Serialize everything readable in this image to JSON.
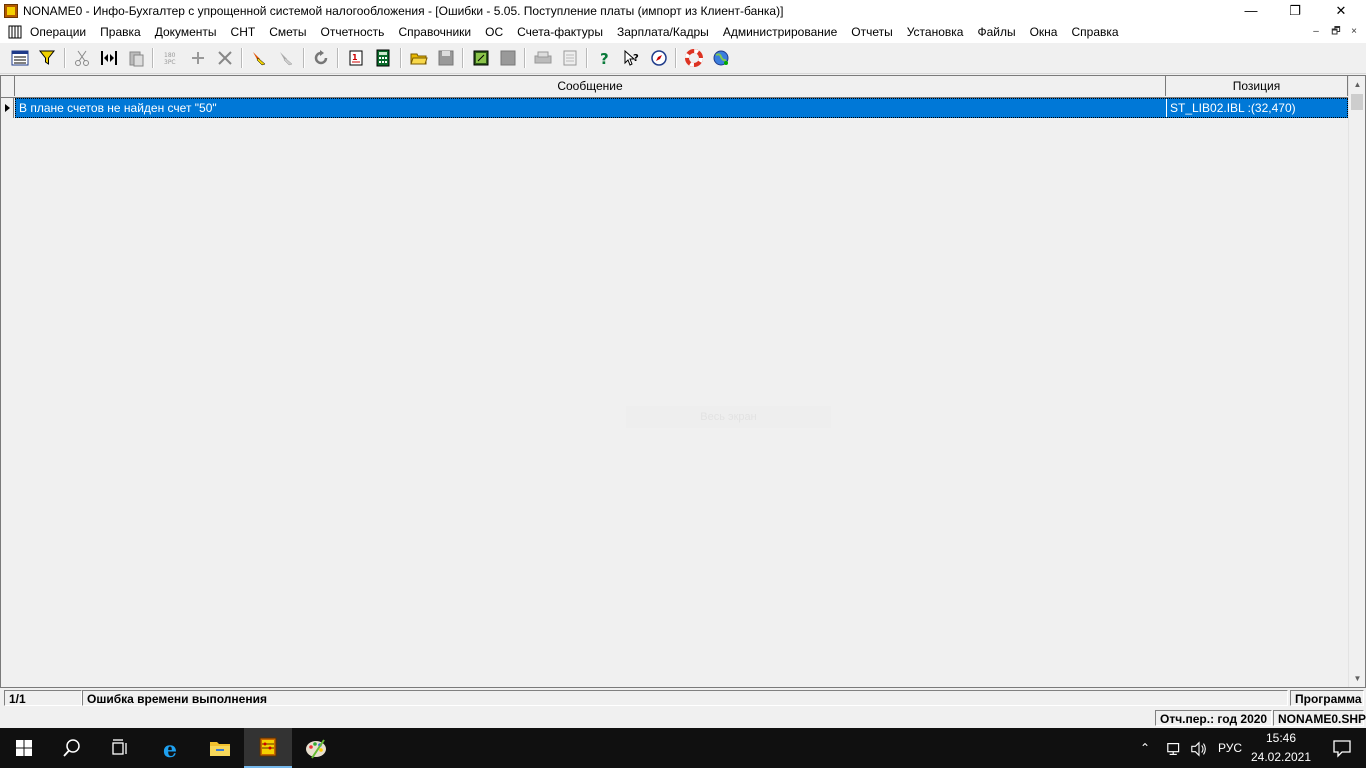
{
  "window": {
    "title": "NONAME0 - Инфо-Бухгалтер с упрощенной системой налогообложения - [Ошибки -  5.05. Поступление платы (импорт из Клиент-банка)]",
    "minimize": "—",
    "maximize": "❐",
    "close": "✕"
  },
  "menu": {
    "items": [
      "Операции",
      "Правка",
      "Документы",
      "СНТ",
      "Сметы",
      "Отчетность",
      "Справочники",
      "ОС",
      "Счета-фактуры",
      "Зарплата/Кадры",
      "Администрирование",
      "Отчеты",
      "Установка",
      "Файлы",
      "Окна",
      "Справка"
    ],
    "mdi_min": "–",
    "mdi_restore": "🗗",
    "mdi_close": "×"
  },
  "toolbar": {
    "icons": [
      "grid-view-icon",
      "filter-icon",
      "cut-icon",
      "move-icon",
      "paste-icon",
      "number-icon",
      "add-icon",
      "delete-icon",
      "mark-icon",
      "unmark-icon",
      "refresh-icon",
      "report-icon",
      "calculator-icon",
      "open-folder-icon",
      "save-icon",
      "export-icon",
      "blank-icon",
      "print-icon",
      "print-preview-icon",
      "help-icon",
      "context-help-icon",
      "compass-icon",
      "lifebuoy-icon",
      "globe-icon"
    ]
  },
  "grid": {
    "columns": [
      "Сообщение",
      "Позиция"
    ],
    "rows": [
      {
        "message": "В плане счетов не найден счет \"50\"",
        "position": "ST_LIB02.IBL :(32,470)"
      }
    ],
    "overlay": "Весь экран"
  },
  "status": {
    "count": "1/1",
    "message": "Ошибка времени выполнения",
    "source": "Программа",
    "period": "Отч.пер.: год 2020",
    "file": "NONAME0.SHP"
  },
  "taskbar": {
    "language": "РУС",
    "time": "15:46",
    "date": "24.02.2021"
  },
  "colors": {
    "selection": "#0078d7",
    "taskbar": "#101010"
  }
}
